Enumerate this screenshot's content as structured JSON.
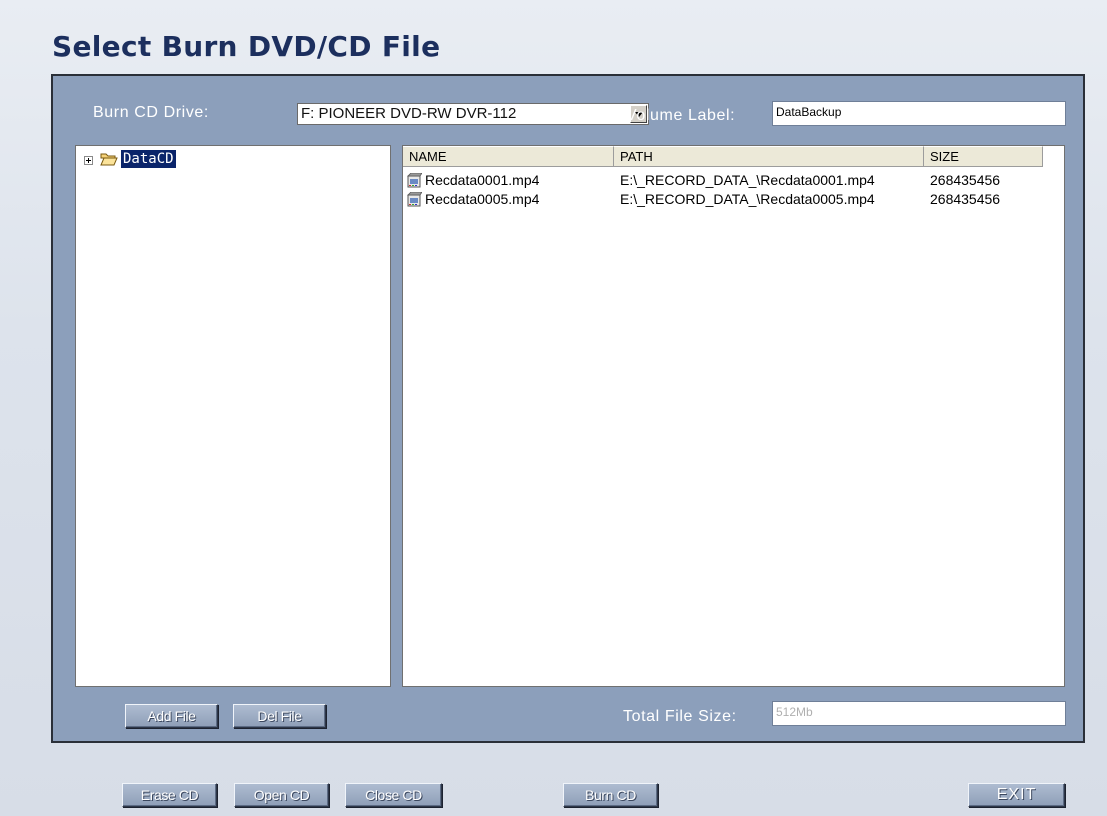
{
  "title": "Select Burn DVD/CD File",
  "drive": {
    "label": "Burn CD Drive:",
    "value": "F: PIONEER DVD-RW DVR-112"
  },
  "volume": {
    "label": "Volume Label:",
    "value": "DataBackup"
  },
  "tree": {
    "root_label": "DataCD"
  },
  "list": {
    "headers": [
      "NAME",
      "PATH",
      "SIZE"
    ],
    "rows": [
      {
        "name": "Recdata0001.mp4",
        "path": "E:\\_RECORD_DATA_\\Recdata0001.mp4",
        "size": "268435456"
      },
      {
        "name": "Recdata0005.mp4",
        "path": "E:\\_RECORD_DATA_\\Recdata0005.mp4",
        "size": "268435456"
      }
    ]
  },
  "buttons": {
    "add_file": "Add File",
    "del_file": "Del File",
    "erase_cd": "Erase CD",
    "open_cd": "Open CD",
    "close_cd": "Close CD",
    "burn_cd": "Burn CD",
    "exit": "EXIT"
  },
  "total": {
    "label": "Total File Size:",
    "value": "512Mb"
  },
  "colors": {
    "panel": "#8c9fbb",
    "title": "#1c2f5e",
    "selection": "#0a246a"
  },
  "icons": {
    "tree_expander": "plus-box-icon",
    "folder": "open-folder-icon",
    "file": "video-file-icon",
    "dropdown": "chevron-down-icon"
  }
}
